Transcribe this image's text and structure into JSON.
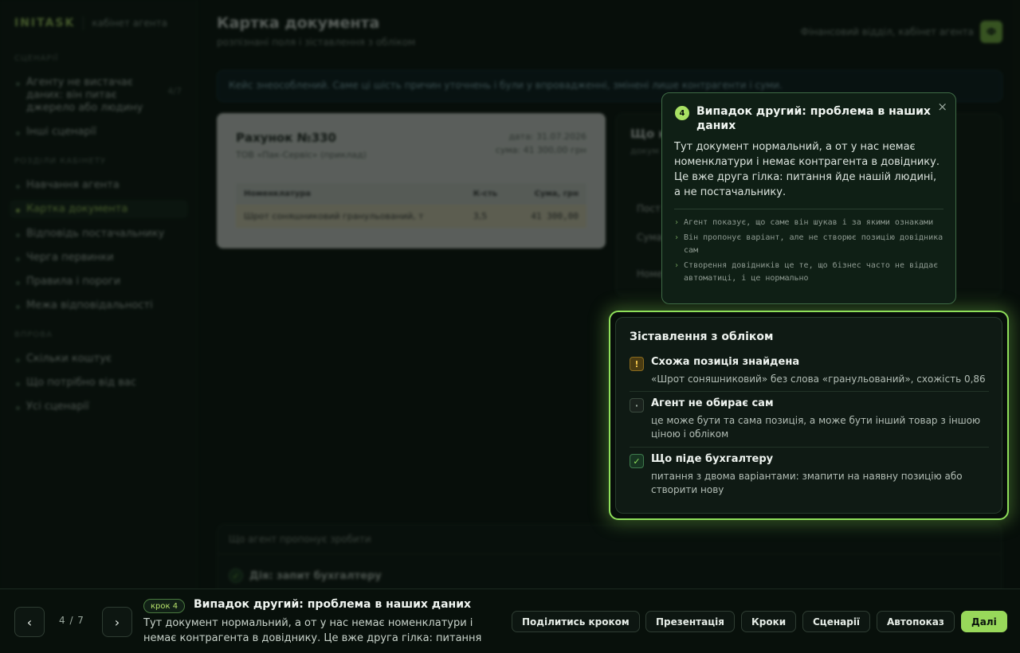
{
  "sidebar": {
    "logo": "INITASK",
    "logo_sub": "кабінет агента",
    "section_scenarios": "СЦЕНАРІЇ",
    "scenario_active": "Агенту не вистачає даних: він питає джерело або людину",
    "scenario_count": "4/7",
    "scenario_other": "Інші сценарії",
    "section_sections": "РОЗДІЛИ КАБІНЕТУ",
    "items": [
      "Навчання агента",
      "Картка документа",
      "Відповідь постачальнику",
      "Черга первинки",
      "Правила і пороги",
      "Межа відповідальності"
    ],
    "section_impl": "ВПРОВА",
    "impl_items": [
      "Скільки коштує",
      "Що потрібно від вас",
      "Усі сценарії"
    ]
  },
  "header": {
    "title": "Картка документа",
    "subtitle": "розпізнані поля і зіставлення з обліком",
    "org": "Фінансовий відділ, кабінет агента",
    "avatar": "Ф"
  },
  "banner": "Кейс знеособлений. Саме ці шість причин уточнень і були у впровадженні, змінені лише контрагенти і суми.",
  "invoice": {
    "title": "Рахунок №330",
    "vendor": "ТОВ «Пак-Сервіс» (приклад)",
    "date": "дата: 31.07.2026",
    "sum": "сума: 41 300,00 грн",
    "columns": [
      "Номенклатура",
      "К-сть",
      "Сума, грн"
    ],
    "row": [
      "Шрот соняшниковий гранульований, т",
      "3,5",
      "41 300,00"
    ]
  },
  "side_card": {
    "title": "Що н",
    "subtitle": "докум",
    "rows": [
      "Пост",
      "Сума",
      "Номе"
    ]
  },
  "match_card": {
    "title": "Зіставлення з обліком",
    "items": [
      {
        "icon": "!",
        "title": "Схожа позиція знайдена",
        "desc": "«Шрот соняшниковий» без слова «гранульований», схожість 0,86"
      },
      {
        "icon": "·",
        "title": "Агент не обирає сам",
        "desc": "це може бути та сама позиція, а може бути інший товар з іншою ціною і обліком"
      },
      {
        "icon": "✓",
        "title": "Що піде бухгалтеру",
        "desc": "питання з двома варіантами: змапити на наявну позицію або створити нову"
      }
    ]
  },
  "tooltip": {
    "number": "4",
    "title": "Випадок другий: проблема в наших даних",
    "body": "Тут документ нормальний, а от у нас немає номенклатури і немає контрагента в довіднику. Це вже друга гілка: питання йде нашій людині, а не постачальнику.",
    "notes": [
      "Агент показує, що саме він шукав і за якими ознаками",
      "Він пропонує варіант, але не створює позицію довідника сам",
      "Створення довідників це те, що бізнес часто не віддає автоматиці, і це нормально"
    ],
    "close": "×"
  },
  "bottom_panel": {
    "head": "Що агент пропонує зробити",
    "action": "Дія: запит бухгалтеру"
  },
  "footer": {
    "prev": "‹",
    "next": "›",
    "pager": "4 / 7",
    "step_badge": "крок 4",
    "step_title": "Випадок другий: проблема в наших даних",
    "step_desc": "Тут документ нормальний, а от у нас немає номенклатури і немає контрагента в довіднику. Це вже друга гілка: питання йде нашій…",
    "buttons": [
      "Поділитись кроком",
      "Презентація",
      "Кроки",
      "Сценарії",
      "Автопоказ",
      "Далі"
    ]
  },
  "colors": {
    "accent": "#98d85a",
    "warn": "#f0c24b",
    "bg": "#0a120d"
  }
}
